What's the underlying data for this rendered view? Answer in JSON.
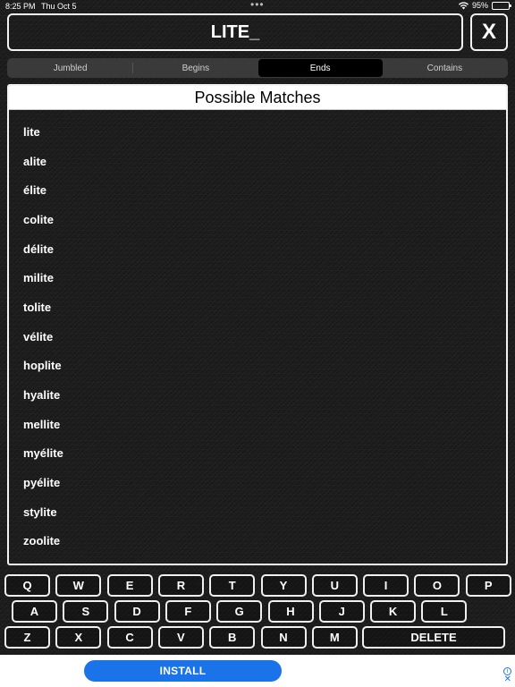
{
  "status_bar": {
    "time": "8:25 PM",
    "date": "Thu Oct 5",
    "dots": "•••",
    "battery_percent": "95%",
    "battery_level": 0.95,
    "battery_color": "#34c759"
  },
  "query": {
    "value": "LITE_",
    "clear_label": "X"
  },
  "tabs": [
    {
      "label": "Jumbled",
      "active": false
    },
    {
      "label": "Begins",
      "active": false
    },
    {
      "label": "Ends",
      "active": true
    },
    {
      "label": "Contains",
      "active": false
    }
  ],
  "results": {
    "title": "Possible Matches",
    "items": [
      "lite",
      "alite",
      "élite",
      "colite",
      "délite",
      "milite",
      "tolite",
      "vélite",
      "hoplite",
      "hyalite",
      "mellite",
      "myélite",
      "pyélite",
      "stylite",
      "zoolite"
    ]
  },
  "keyboard": {
    "rows": [
      [
        "Q",
        "W",
        "E",
        "R",
        "T",
        "Y",
        "U",
        "I",
        "O",
        "P"
      ],
      [
        "A",
        "S",
        "D",
        "F",
        "G",
        "H",
        "J",
        "K",
        "L"
      ],
      [
        "Z",
        "X",
        "C",
        "V",
        "B",
        "N",
        "M"
      ]
    ],
    "delete_label": "DELETE"
  },
  "ad": {
    "install_label": "INSTALL",
    "accent_color": "#1a73e8",
    "info_icon": "info-icon",
    "close_icon": "close-icon"
  }
}
